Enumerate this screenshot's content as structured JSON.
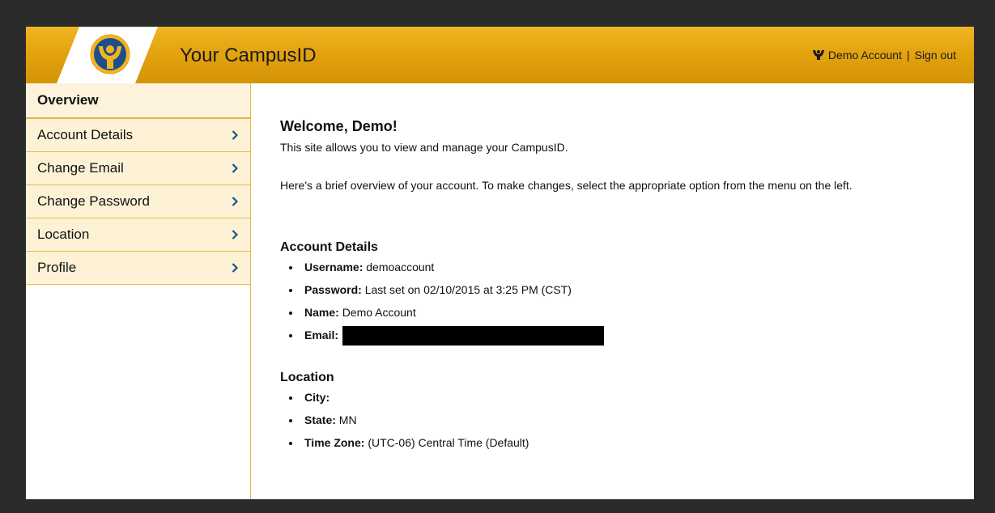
{
  "header": {
    "title": "Your CampusID",
    "user_name": "Demo Account",
    "separator": "|",
    "sign_out": "Sign out"
  },
  "sidebar": {
    "items": [
      {
        "label": "Overview"
      },
      {
        "label": "Account Details"
      },
      {
        "label": "Change Email"
      },
      {
        "label": "Change Password"
      },
      {
        "label": "Location"
      },
      {
        "label": "Profile"
      }
    ]
  },
  "main": {
    "welcome": "Welcome, Demo!",
    "intro": "This site allows you to view and manage your CampusID.",
    "overview_text": "Here's a brief overview of your account. To make changes, select the appropriate option from the menu on the left.",
    "account_details": {
      "heading": "Account Details",
      "username_label": "Username:",
      "username": "demoaccount",
      "password_label": "Password:",
      "password": "Last set on 02/10/2015 at 3:25 PM (CST)",
      "name_label": "Name:",
      "name": "Demo Account",
      "email_label": "Email:"
    },
    "location": {
      "heading": "Location",
      "city_label": "City:",
      "city": "",
      "state_label": "State:",
      "state": "MN",
      "timezone_label": "Time Zone:",
      "timezone": "(UTC-06) Central Time (Default)"
    }
  },
  "colors": {
    "header_gold": "#e1a00d",
    "nav_bg": "#fdf2d5",
    "nav_border": "#e9bd4d",
    "chevron": "#1f4e8c"
  }
}
